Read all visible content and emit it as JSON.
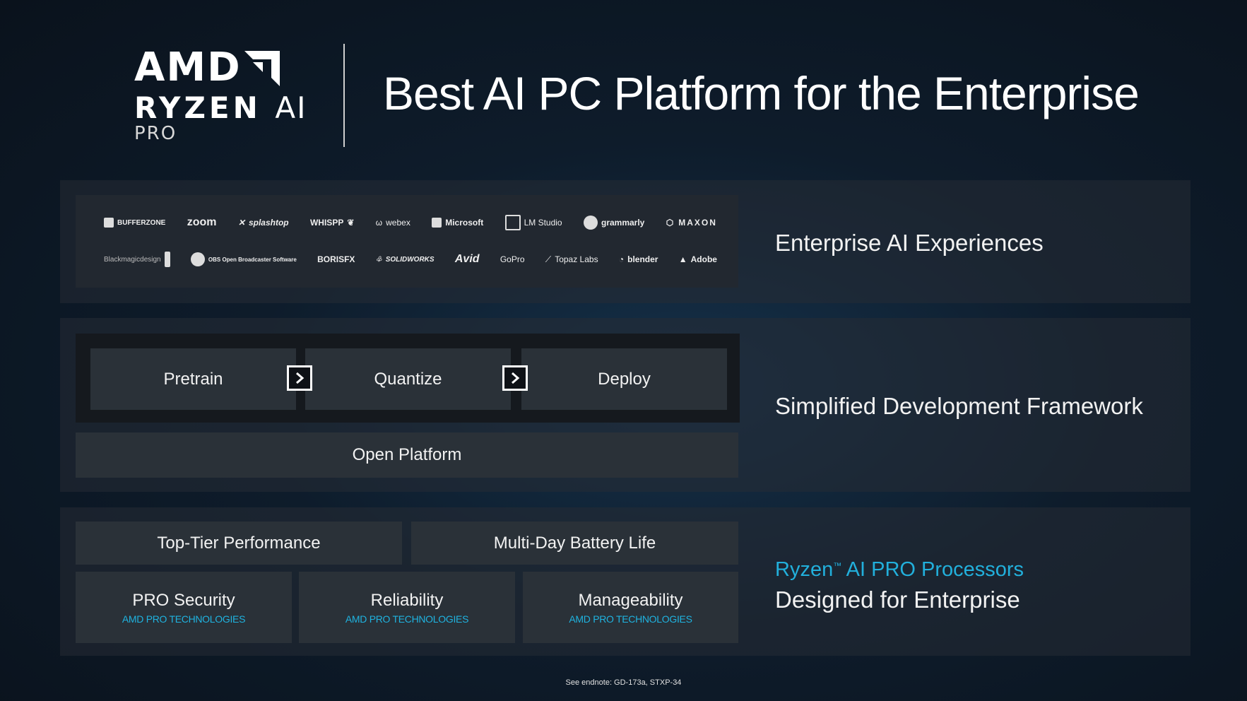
{
  "logo": {
    "amd": "AMD",
    "ryzen": "RYZEN",
    "ai": "AI",
    "pro": "PRO"
  },
  "headline": "Best AI PC Platform for the Enterprise",
  "partners_row1": [
    "BUFFERZONE",
    "zoom",
    "splashtop",
    "WHISPP",
    "webex",
    "Microsoft",
    "LM Studio",
    "grammarly",
    "MAXON"
  ],
  "partners_row2": [
    "Blackmagicdesign",
    "OBS Open Broadcaster Software",
    "BORISFX",
    "SOLIDWORKS",
    "Avid",
    "GoPro",
    "Topaz Labs",
    "blender",
    "Adobe"
  ],
  "row1_label": "Enterprise AI Experiences",
  "row2": {
    "steps": [
      "Pretrain",
      "Quantize",
      "Deploy"
    ],
    "open_platform": "Open Platform",
    "label": "Simplified Development Framework"
  },
  "row3": {
    "top_tier": "Top-Tier Performance",
    "battery": "Multi-Day Battery Life",
    "features": [
      {
        "title": "PRO Security",
        "sub": "AMD PRO TECHNOLOGIES"
      },
      {
        "title": "Reliability",
        "sub": "AMD PRO TECHNOLOGIES"
      },
      {
        "title": "Manageability",
        "sub": "AMD PRO TECHNOLOGIES"
      }
    ],
    "ryzen": "Ryzen",
    "tm": "™",
    "processors": " AI PRO Processors",
    "designed": "Designed for Enterprise"
  },
  "endnote": "See endnote: GD-173a, STXP-34",
  "colors": {
    "accent": "#22b0dc",
    "background": "#0e1c2b",
    "panel": "#2a3138"
  }
}
